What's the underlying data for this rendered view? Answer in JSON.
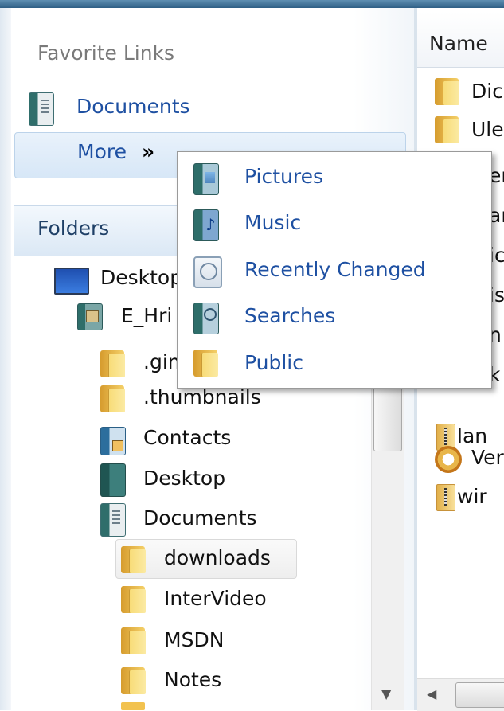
{
  "nav_pane": {
    "favorite_links": {
      "heading": "Favorite Links",
      "items": [
        {
          "label": "Documents",
          "icon": "documents-icon"
        }
      ],
      "more_label": "More",
      "more_glyph": "»"
    },
    "folders_heading": "Folders",
    "tree": [
      {
        "label": "Desktop",
        "icon": "desktop-icon"
      },
      {
        "label": "E_Hri",
        "icon": "user-folder-icon"
      },
      {
        "label": ".gimp",
        "icon": "folder-icon"
      },
      {
        "label": ".thumbnails",
        "icon": "folder-icon"
      },
      {
        "label": "Contacts",
        "icon": "contacts-icon"
      },
      {
        "label": "Desktop",
        "icon": "desktop-folder-icon"
      },
      {
        "label": "Documents",
        "icon": "documents-icon"
      },
      {
        "label": "downloads",
        "icon": "folder-icon",
        "selected": true
      },
      {
        "label": "InterVideo",
        "icon": "folder-icon"
      },
      {
        "label": "MSDN",
        "icon": "folder-icon"
      },
      {
        "label": "Notes",
        "icon": "folder-icon"
      }
    ]
  },
  "popup_menu": {
    "items": [
      {
        "label": "Pictures",
        "icon": "pictures-icon"
      },
      {
        "label": "Music",
        "icon": "music-icon"
      },
      {
        "label": "Recently Changed",
        "icon": "recently-changed-icon"
      },
      {
        "label": "Searches",
        "icon": "searches-icon"
      },
      {
        "label": "Public",
        "icon": "folder-icon"
      }
    ]
  },
  "file_list": {
    "column_header": "Name",
    "rows": [
      {
        "text": "Dic",
        "icon": "folder-icon"
      },
      {
        "text": "Ule",
        "icon": "folder-icon"
      },
      {
        "text": "er",
        "icon": "folder-icon"
      },
      {
        "text": "ar",
        "icon": "folder-icon"
      },
      {
        "text": "ic",
        "icon": "folder-icon"
      },
      {
        "text": "is",
        "icon": "folder-icon"
      },
      {
        "text": "n",
        "icon": "folder-icon"
      },
      {
        "text": "k",
        "icon": "folder-icon"
      },
      {
        "text": "lan",
        "icon": "zip-folder-icon"
      },
      {
        "text": "Ver",
        "icon": "gear-icon"
      },
      {
        "text": "wir",
        "icon": "zip-folder-icon"
      }
    ]
  },
  "colors": {
    "link_blue": "#1e50a2",
    "heading_gray": "#7a7a7a",
    "selection_bg": "#d7e7f7"
  }
}
